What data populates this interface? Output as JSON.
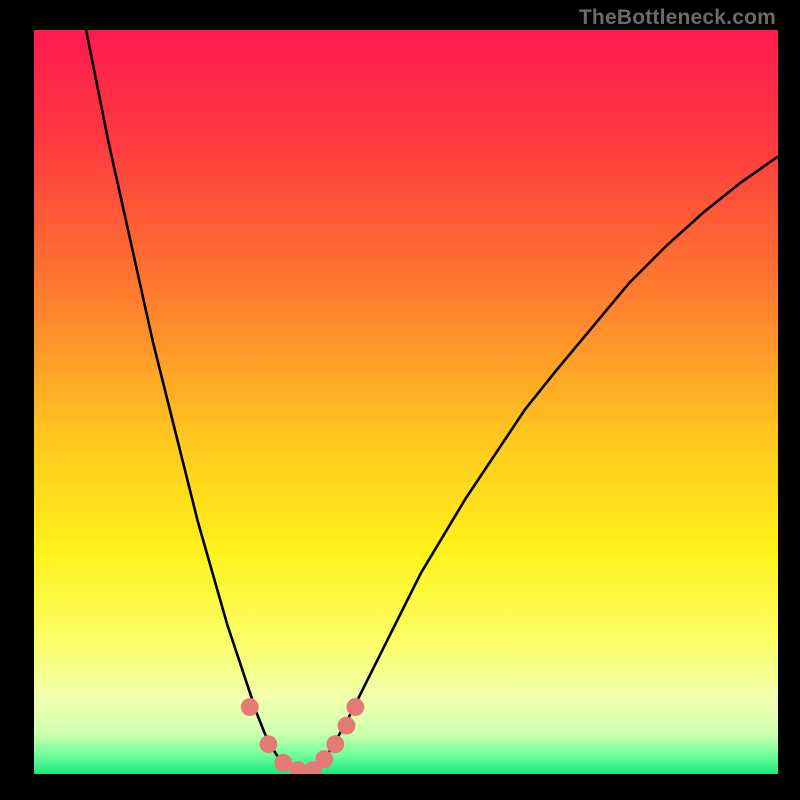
{
  "watermark": {
    "text": "TheBottleneck.com"
  },
  "colors": {
    "background": "#000000",
    "curve_stroke": "#000000",
    "marker_fill": "#e47a73",
    "gradient_stops": [
      {
        "offset": 0.0,
        "color": "#ff1a4f"
      },
      {
        "offset": 0.15,
        "color": "#ff3a3f"
      },
      {
        "offset": 0.35,
        "color": "#ff7a2f"
      },
      {
        "offset": 0.55,
        "color": "#ffc81f"
      },
      {
        "offset": 0.7,
        "color": "#fff21a"
      },
      {
        "offset": 0.82,
        "color": "#fcff66"
      },
      {
        "offset": 0.9,
        "color": "#f0ffb0"
      },
      {
        "offset": 0.945,
        "color": "#d0ffb0"
      },
      {
        "offset": 0.975,
        "color": "#6fff9a"
      },
      {
        "offset": 1.0,
        "color": "#17e87a"
      }
    ]
  },
  "chart_data": {
    "type": "line",
    "title": "",
    "xlabel": "",
    "ylabel": "",
    "xlim": [
      0,
      100
    ],
    "ylim": [
      0,
      100
    ],
    "x": [
      7.0,
      8.2,
      10.0,
      12.0,
      14.0,
      16.0,
      18.0,
      20.0,
      22.0,
      24.0,
      26.0,
      28.0,
      29.0,
      30.0,
      31.0,
      32.0,
      33.0,
      34.0,
      35.0,
      36.0,
      37.0,
      38.0,
      39.0,
      40.0,
      42.0,
      44.0,
      46.0,
      48.0,
      50.0,
      52.0,
      55.0,
      58.0,
      62.0,
      66.0,
      70.0,
      75.0,
      80.0,
      85.0,
      90.0,
      95.0,
      100.0
    ],
    "values": [
      100.0,
      94.0,
      85.0,
      76.0,
      67.0,
      58.0,
      50.0,
      42.0,
      34.0,
      27.0,
      20.0,
      14.0,
      11.0,
      8.0,
      5.5,
      3.5,
      2.0,
      1.0,
      0.5,
      0.3,
      0.5,
      1.0,
      2.0,
      3.5,
      7.0,
      11.0,
      15.0,
      19.0,
      23.0,
      27.0,
      32.0,
      37.0,
      43.0,
      49.0,
      54.0,
      60.0,
      66.0,
      71.0,
      75.5,
      79.5,
      83.0
    ],
    "markers": {
      "x": [
        29.0,
        31.5,
        33.5,
        35.5,
        37.5,
        39.0,
        40.5,
        42.0,
        43.2
      ],
      "values": [
        9.0,
        4.0,
        1.5,
        0.5,
        0.5,
        2.0,
        4.0,
        6.5,
        9.0
      ]
    },
    "grid": false,
    "legend": false
  }
}
